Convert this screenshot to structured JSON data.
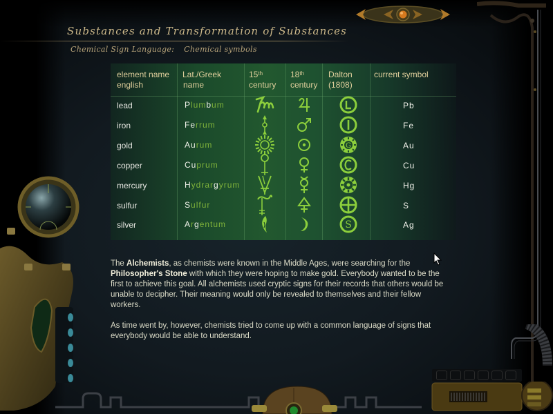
{
  "header": {
    "title": "Substances and Transformation of Substances",
    "subtitle_section": "Chemical Sign Language:",
    "subtitle_topic": "Chemical symbols"
  },
  "table": {
    "columns": [
      {
        "line1": "element name",
        "line2": "english"
      },
      {
        "line1": "Lat./Greek",
        "line2": "name"
      },
      {
        "line1": "15",
        "sup": "th",
        "line2": "century"
      },
      {
        "line1": "18",
        "sup": "th",
        "line2": "century"
      },
      {
        "line1": "Dalton",
        "line2": "(1808)"
      },
      {
        "line1": "current symbol",
        "line2": ""
      }
    ],
    "rows": [
      {
        "english": "lead",
        "latin_parts": [
          [
            "P",
            true
          ],
          [
            "lum",
            false
          ],
          [
            "b",
            true
          ],
          [
            "um",
            false
          ]
        ],
        "glyph_15th": "lead-15th-century-icon",
        "glyph_18th": "jupiter-icon",
        "glyph_dalton": "dalton-L-icon",
        "symbol": "Pb"
      },
      {
        "english": "iron",
        "latin_parts": [
          [
            "Fe",
            true
          ],
          [
            "rrum",
            false
          ]
        ],
        "glyph_15th": "iron-15th-century-icon",
        "glyph_18th": "mars-icon",
        "glyph_dalton": "dalton-I-icon",
        "symbol": "Fe"
      },
      {
        "english": "gold",
        "latin_parts": [
          [
            "Au",
            true
          ],
          [
            "rum",
            false
          ]
        ],
        "glyph_15th": "sun-rays-icon",
        "glyph_18th": "sun-circle-dot-icon",
        "glyph_dalton": "dalton-G-icon",
        "symbol": "Au"
      },
      {
        "english": "copper",
        "latin_parts": [
          [
            "Cu",
            true
          ],
          [
            "prum",
            false
          ]
        ],
        "glyph_15th": "copper-15th-century-icon",
        "glyph_18th": "venus-icon",
        "glyph_dalton": "dalton-C-icon",
        "symbol": "Cu"
      },
      {
        "english": "mercury",
        "latin_parts": [
          [
            "H",
            true
          ],
          [
            "ydrar",
            false
          ],
          [
            "g",
            true
          ],
          [
            "yrum",
            false
          ]
        ],
        "glyph_15th": "mercury-15th-century-icon",
        "glyph_18th": "mercury-icon",
        "glyph_dalton": "dalton-star-icon",
        "symbol": "Hg"
      },
      {
        "english": "sulfur",
        "latin_parts": [
          [
            "S",
            true
          ],
          [
            "ulfur",
            false
          ]
        ],
        "glyph_15th": "sulfur-15th-century-icon",
        "glyph_18th": "sulfur-triangle-cross-icon",
        "glyph_dalton": "dalton-cross-circle-icon",
        "symbol": "S"
      },
      {
        "english": "silver",
        "latin_parts": [
          [
            "A",
            true
          ],
          [
            "r",
            false
          ],
          [
            "g",
            true
          ],
          [
            "entum",
            false
          ]
        ],
        "glyph_15th": "moon-15th-century-icon",
        "glyph_18th": "crescent-moon-icon",
        "glyph_dalton": "dalton-S-icon",
        "symbol": "Ag"
      }
    ]
  },
  "body": {
    "p1_prefix": "The ",
    "p1_bold1": "Alchemists",
    "p1_mid": ", as chemists were known in the Middle Ages, were searching for the ",
    "p1_bold2": "Philosopher's Stone",
    "p1_suffix": " with which they were hoping to make gold. Everybody wanted to be the first to achieve this goal. All alchemists used cryptic signs for their records that others would be unable to decipher. Their meaning would only be revealed to themselves and their fellow workers.",
    "p2": "As time went by, however, chemists tried to come up with a common language of signs that everybody would be able to understand."
  },
  "colors": {
    "glyph_green": "#8ccf3c",
    "header_gold": "#e0cf9c",
    "title_gold": "#cdb98a",
    "latin_green": "#7fb23a"
  }
}
